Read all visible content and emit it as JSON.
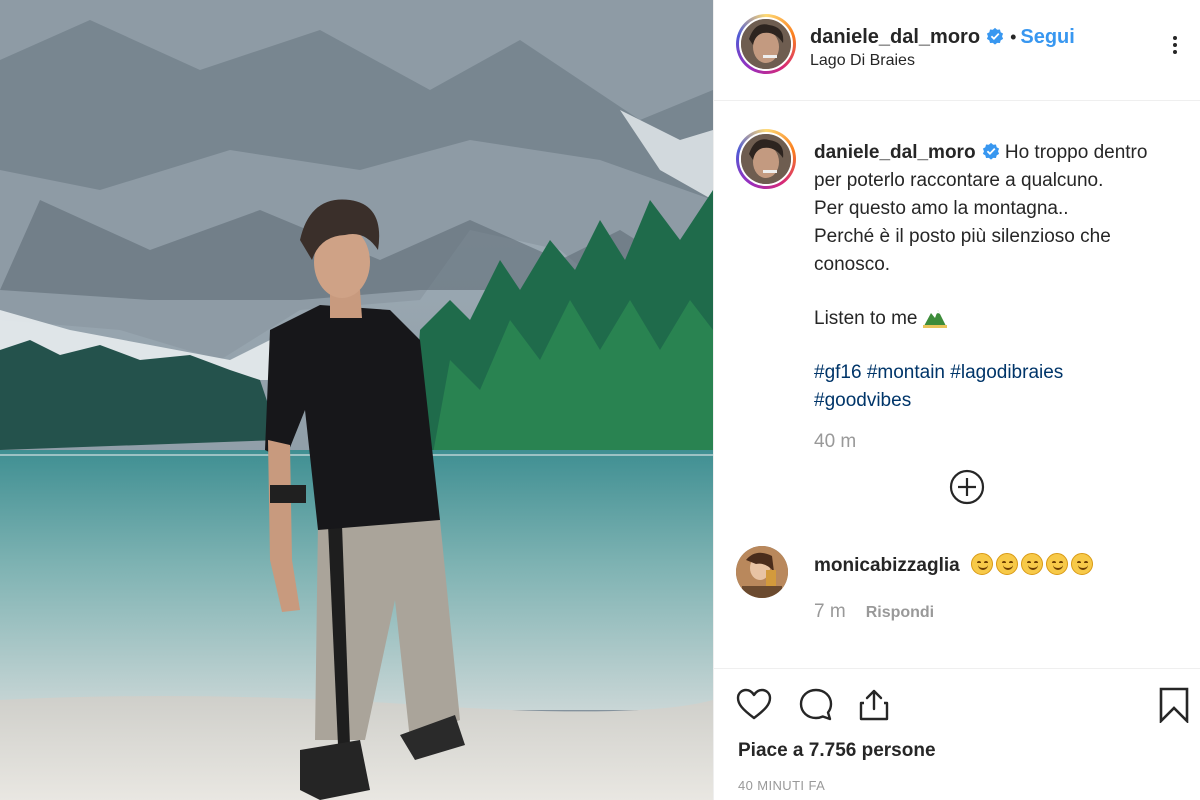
{
  "post": {
    "username": "daniele_dal_moro",
    "follow_label": "Segui",
    "separator": "•",
    "location": "Lago Di Braies"
  },
  "caption": {
    "username": "daniele_dal_moro",
    "lines": [
      "Ho troppo dentro",
      "per poterlo raccontare a qualcuno.",
      "Per questo amo la montagna..",
      "Perché è il posto più silenzioso che",
      "conosco."
    ],
    "listen": "Listen to me",
    "hashtags_line1": [
      "#gf16",
      "#montain",
      "#lagodibraies"
    ],
    "hashtags_line2": [
      "#goodvibes"
    ],
    "time": "40 m"
  },
  "comment": {
    "username": "monicabizzaglia",
    "emoji_count": 5,
    "emoji_name": "smiling-face-icon",
    "time": "7 m",
    "reply_label": "Rispondi"
  },
  "footer": {
    "likes": "Piace a 7.756 persone",
    "ago": "40 MINUTI FA"
  },
  "colors": {
    "link_blue": "#3897f0",
    "hashtag": "#003569",
    "muted": "#999999",
    "text": "#262626"
  }
}
